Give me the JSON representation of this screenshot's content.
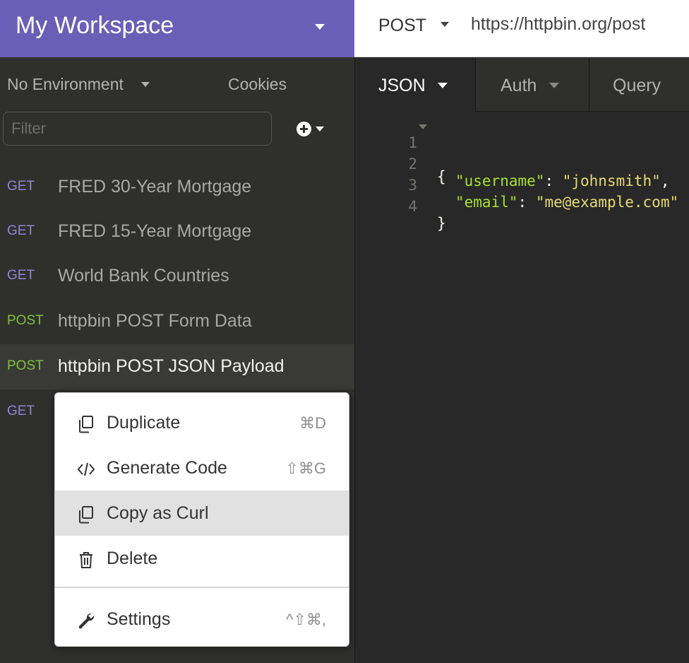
{
  "workspace": {
    "title": "My Workspace"
  },
  "environment": {
    "label": "No Environment",
    "cookies_label": "Cookies"
  },
  "filter": {
    "placeholder": "Filter"
  },
  "colors": {
    "get": "#8f85d6",
    "post": "#7fc240",
    "accent": "#6b5eb7"
  },
  "requests": [
    {
      "method": "GET",
      "name": "FRED 30-Year Mortgage"
    },
    {
      "method": "GET",
      "name": "FRED 15-Year Mortgage"
    },
    {
      "method": "GET",
      "name": "World Bank Countries"
    },
    {
      "method": "POST",
      "name": "httpbin POST Form Data"
    },
    {
      "method": "POST",
      "name": "httpbin POST JSON Payload",
      "active": true
    },
    {
      "method": "GET",
      "name": ""
    }
  ],
  "urlbar": {
    "method": "POST",
    "url": "https://httpbin.org/post"
  },
  "tabs": {
    "body": "JSON",
    "auth": "Auth",
    "query": "Query"
  },
  "code": {
    "line_numbers": [
      "1",
      "2",
      "3",
      "4"
    ],
    "open": "{",
    "close": "}",
    "username_key": "\"username\"",
    "username_value": "\"johnsmith\"",
    "email_key": "\"email\"",
    "email_value": "\"me@example.com\""
  },
  "menu": {
    "items": [
      {
        "label": "Duplicate",
        "shortcut": "⌘D",
        "icon": "duplicate-icon"
      },
      {
        "label": "Generate Code",
        "shortcut": "⇧⌘G",
        "icon": "code-icon"
      },
      {
        "label": "Copy as Curl",
        "shortcut": "",
        "icon": "copy-icon",
        "highlighted": true
      },
      {
        "label": "Delete",
        "shortcut": "",
        "icon": "trash-icon"
      },
      {
        "label": "Settings",
        "shortcut": "^⇧⌘,",
        "icon": "wrench-icon"
      }
    ]
  }
}
